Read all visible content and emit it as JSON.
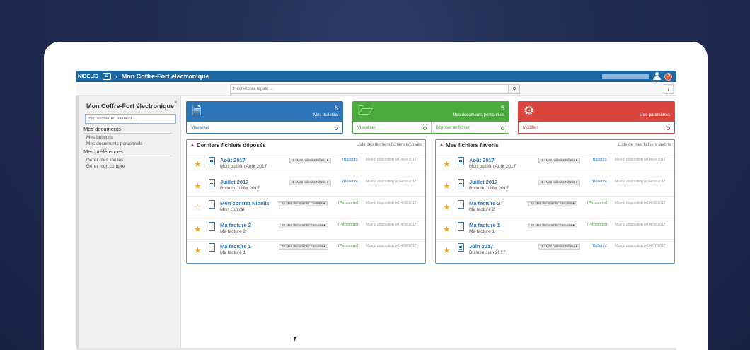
{
  "topbar": {
    "logo": "NIBELIS",
    "app_title": "Mon Coffre-Fort électronique",
    "crumb_sep": "›"
  },
  "search": {
    "placeholder": "Rechercher rapide ..."
  },
  "sidebar": {
    "title": "Mon Coffre-Fort électronique",
    "close": "×",
    "search_placeholder": "Rechercher un élément ...",
    "sections": [
      {
        "heading": "Mes documents",
        "links": [
          "Mes bulletins",
          "Mes documents personnels"
        ]
      },
      {
        "heading": "Mes préférences",
        "links": [
          "Gérer mes libellés",
          "Gérer mon compte"
        ]
      }
    ]
  },
  "cards": [
    {
      "count": "8",
      "label": "Mes bulletins",
      "actions": [
        "Visualiser"
      ]
    },
    {
      "count": "5",
      "label": "Mes documents personnels",
      "actions": [
        "Visualiser",
        "Déposer un fichier"
      ]
    },
    {
      "count": "",
      "label": "Mes paramètres",
      "actions": [
        "Modifier"
      ]
    }
  ],
  "colors": {
    "blue": "#2d74b8",
    "green": "#4aaa3c",
    "red": "#d9443f",
    "topbar": "#1d69a3",
    "star": "#f0a81e"
  },
  "panels": {
    "recent": {
      "title": "Derniers fichiers déposés",
      "link": "Liste des derniers fichiers archivés",
      "rows": [
        {
          "title": "Août 2017",
          "sub": "Mon bulletin Août 2017",
          "tag": "1 - Mes bulletins Nibelis ▾",
          "cat": "(Bulletin)",
          "date": "Mise à disposition le 04/09/2017",
          "fav": true,
          "perso": false
        },
        {
          "title": "Juillet 2017",
          "sub": "Bulletin Juillet 2017",
          "tag": "1 - Mes bulletins Nibelis ▾",
          "cat": "(Bulletin)",
          "date": "Mise à disposition le 04/08/2017",
          "fav": true,
          "perso": false
        },
        {
          "title": "Mon contrat Nibelis",
          "sub": "Mon contrat",
          "tag": "2 - Mes documents/ Contrats ▾",
          "cat": "(Personnel)",
          "date": "Mise à disposition le 04/08/2017",
          "fav": false,
          "perso": true
        },
        {
          "title": "Ma facture 2",
          "sub": "Ma facture 2",
          "tag": "2 - Mes documents/ Factures ▾",
          "cat": "(Personnel)",
          "date": "Mise à disposition le 04/08/2017",
          "fav": true,
          "perso": true
        },
        {
          "title": "Ma facture 1",
          "sub": "Ma facture 1",
          "tag": "2 - Mes documents/ Factures ▾",
          "cat": "(Personnel)",
          "date": "Mise à disposition le 04/08/2017",
          "fav": true,
          "perso": true
        }
      ]
    },
    "favorites": {
      "title": "Mes fichiers favoris",
      "link": "Liste de mes fichiers favoris",
      "rows": [
        {
          "title": "Août 2017",
          "sub": "Mon bulletin Août 2017",
          "tag": "1 - Mes bulletins Nibelis ▾",
          "cat": "(Bulletin)",
          "date": "Mise à disposition le 04/09/2017",
          "fav": true,
          "perso": false
        },
        {
          "title": "Juillet 2017",
          "sub": "Bulletin Juillet 2017",
          "tag": "1 - Mes bulletins Nibelis ▾",
          "cat": "(Bulletin)",
          "date": "Mise à disposition le 04/08/2017",
          "fav": true,
          "perso": false
        },
        {
          "title": "Ma facture 2",
          "sub": "Ma facture 2",
          "tag": "2 - Mes documents/ Factures ▾",
          "cat": "(Personnel)",
          "date": "Mise à disposition le 04/08/2017",
          "fav": true,
          "perso": true
        },
        {
          "title": "Ma facture 1",
          "sub": "Ma facture 1",
          "tag": "2 - Mes documents/ Factures ▾",
          "cat": "(Personnel)",
          "date": "Mise à disposition le 04/08/2017",
          "fav": true,
          "perso": true
        },
        {
          "title": "Juin 2017",
          "sub": "Bulletin Juin 2017",
          "tag": "1 - Mes bulletins Nibelis ▾",
          "cat": "(Bulletin)",
          "date": "Mise à disposition le 04/07/2017",
          "fav": true,
          "perso": false
        }
      ]
    }
  }
}
